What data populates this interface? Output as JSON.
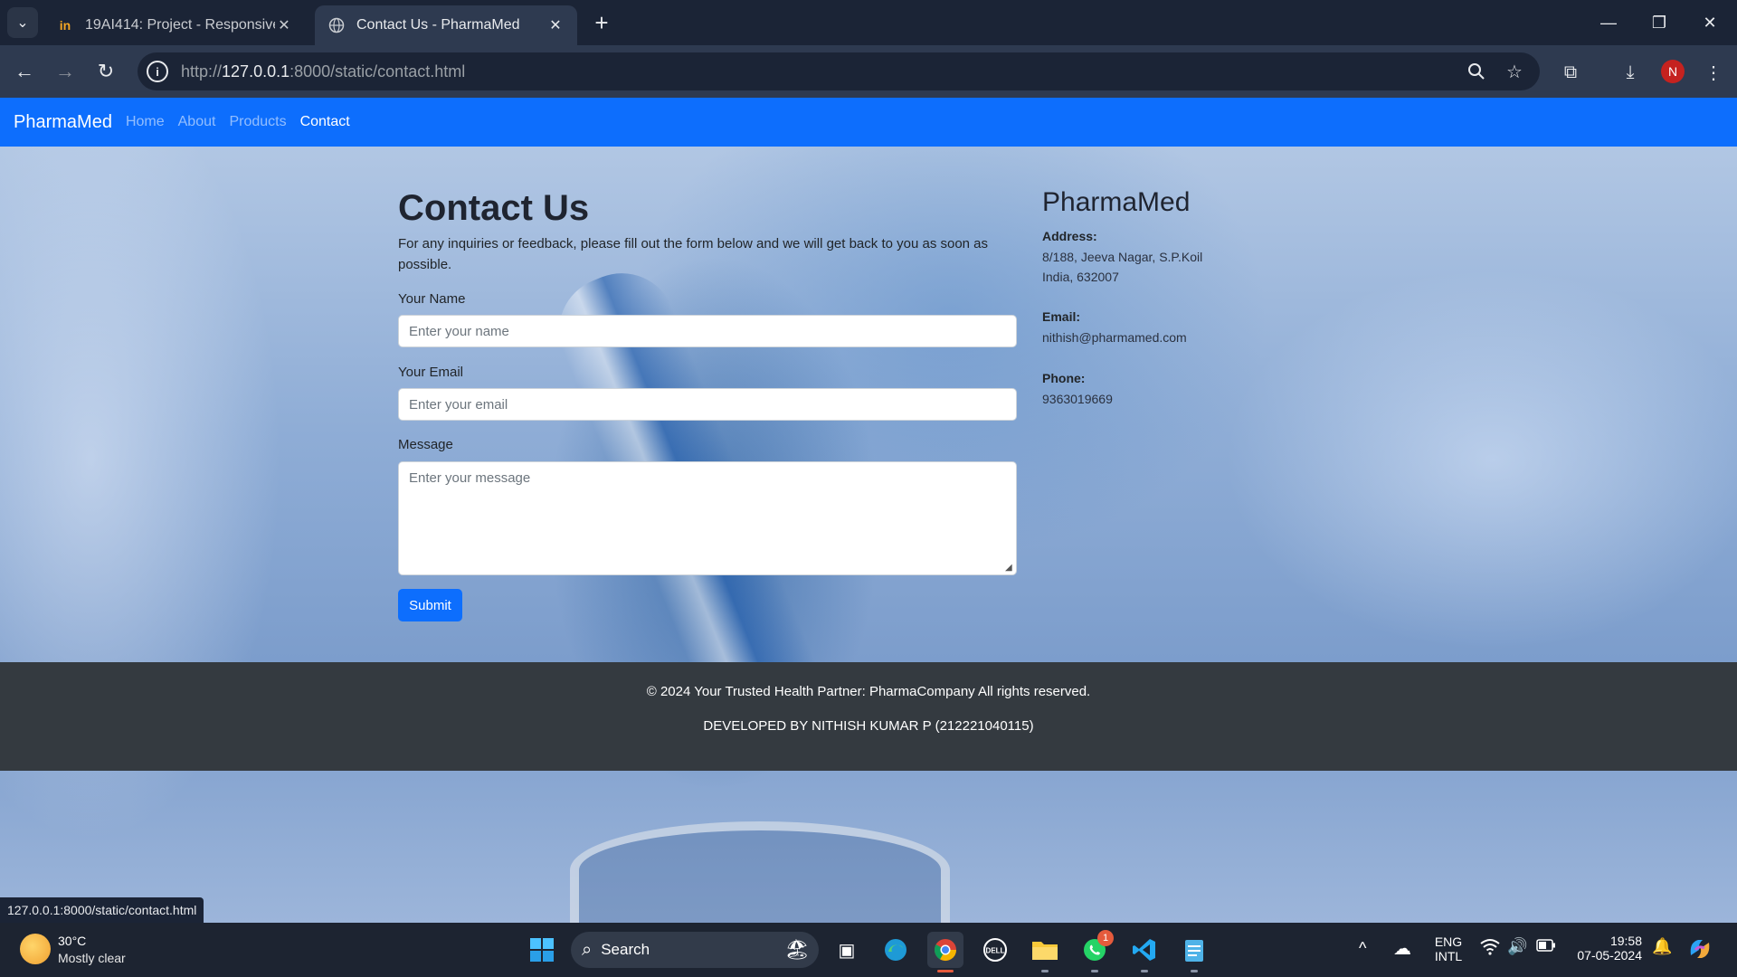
{
  "browser": {
    "tabs": [
      {
        "title": "19AI414: Project - Responsive W",
        "favicon": "in-icon",
        "active": false
      },
      {
        "title": "Contact Us - PharmaMed",
        "favicon": "globe-icon",
        "active": true
      }
    ],
    "url": {
      "scheme": "http://",
      "host": "127.0.0.1",
      "rest": ":8000/static/contact.html"
    },
    "profile_initial": "N",
    "status_url": "127.0.0.1:8000/static/contact.html"
  },
  "navbar": {
    "brand": "PharmaMed",
    "links": [
      "Home",
      "About",
      "Products",
      "Contact"
    ],
    "active": "Contact",
    "color": "#0d6efd"
  },
  "contact": {
    "title": "Contact Us",
    "intro": "For any inquiries or feedback, please fill out the form below and we will get back to you as soon as possible.",
    "name_label": "Your Name",
    "name_placeholder": "Enter your name",
    "email_label": "Your Email",
    "email_placeholder": "Enter your email",
    "message_label": "Message",
    "message_placeholder": "Enter your message",
    "submit_label": "Submit"
  },
  "company": {
    "title": "PharmaMed",
    "address_label": "Address:",
    "address_line1": "8/188, Jeeva Nagar, S.P.Koil",
    "address_line2": "India, 632007",
    "email_label": "Email:",
    "email": "nithish@pharmamed.com",
    "phone_label": "Phone:",
    "phone": "9363019669"
  },
  "footer": {
    "copyright": "© 2024 Your Trusted Health Partner: PharmaCompany All rights reserved.",
    "developer": "DEVELOPED BY NITHISH KUMAR P (212221040115)"
  },
  "taskbar": {
    "weather_temp": "30°C",
    "weather_desc": "Mostly clear",
    "search_label": "Search",
    "whatsapp_badge": "1",
    "lang_top": "ENG",
    "lang_bottom": "INTL",
    "time": "19:58",
    "date": "07-05-2024"
  }
}
